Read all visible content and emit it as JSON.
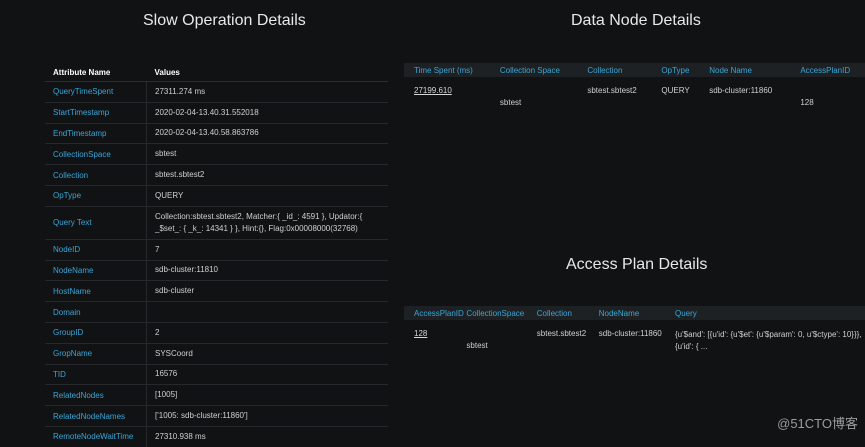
{
  "slow_operation": {
    "title": "Slow Operation Details",
    "col_attribute": "Attribute Name",
    "col_values": "Values",
    "rows": [
      {
        "key": "QueryTimeSpent",
        "value": "27311.274 ms"
      },
      {
        "key": "StartTimestamp",
        "value": "2020-02-04-13.40.31.552018"
      },
      {
        "key": "EndTimestamp",
        "value": "2020-02-04-13.40.58.863786"
      },
      {
        "key": "CollectionSpace",
        "value": "sbtest"
      },
      {
        "key": "Collection",
        "value": "sbtest.sbtest2"
      },
      {
        "key": "OpType",
        "value": "QUERY"
      },
      {
        "key": "Query Text",
        "value": "Collection:sbtest.sbtest2, Matcher:{ _id_: 4591 }, Updator:{ _$set_: { _k_: 14341 } }, Hint:{}, Flag:0x00008000(32768)"
      },
      {
        "key": "NodeID",
        "value": "7"
      },
      {
        "key": "NodeName",
        "value": "sdb-cluster:11810"
      },
      {
        "key": "HostName",
        "value": "sdb-cluster"
      },
      {
        "key": "Domain",
        "value": ""
      },
      {
        "key": "GroupID",
        "value": "2"
      },
      {
        "key": "GropName",
        "value": "SYSCoord"
      },
      {
        "key": "TID",
        "value": "16576"
      },
      {
        "key": "RelatedNodes",
        "value": "[1005]"
      },
      {
        "key": "RelatedNodeNames",
        "value": "['1005: sdb-cluster:11860']"
      },
      {
        "key": "RemoteNodeWaitTime",
        "value": "27310.938 ms"
      }
    ]
  },
  "data_node": {
    "title": "Data Node Details",
    "headers": [
      "Time Spent (ms)",
      "Collection Space",
      "Collection",
      "OpType",
      "Node Name",
      "AccessPlanID"
    ],
    "row": {
      "time_spent": "27199.610",
      "collection_space": "sbtest",
      "collection": "sbtest.sbtest2",
      "op_type": "QUERY",
      "node_name": "sdb-cluster:11860",
      "access_plan_id": "128"
    }
  },
  "access_plan": {
    "title": "Access Plan Details",
    "headers": [
      "AccessPlanID",
      "CollectionSpace",
      "Collection",
      "NodeName",
      "Query"
    ],
    "row": {
      "access_plan_id": "128",
      "collection_space": "sbtest",
      "collection": "sbtest.sbtest2",
      "node_name": "sdb-cluster:11860",
      "query": "{u'$and': [{u'id': {u'$et': {u'$param': 0, u'$ctype': 10}}}, {u'id': { ..."
    }
  },
  "watermark": "@51CTO博客"
}
